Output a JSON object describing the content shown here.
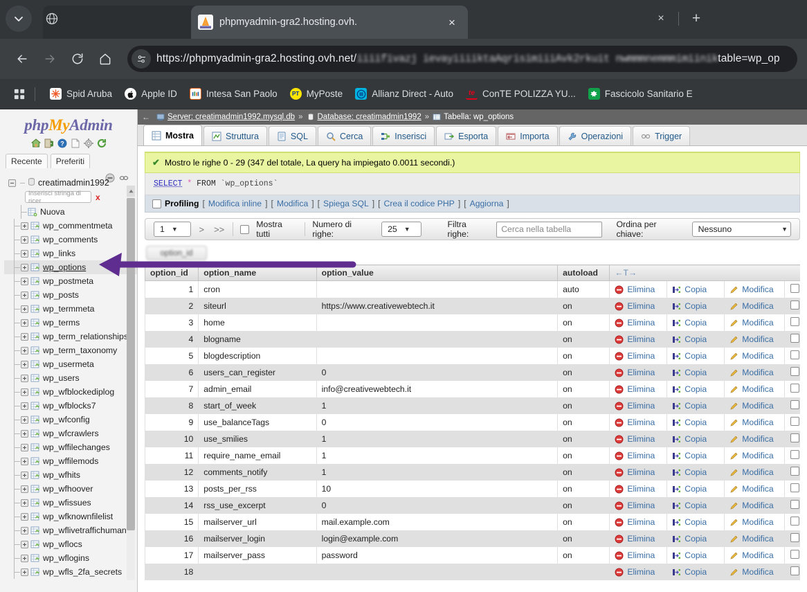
{
  "browser": {
    "tab": {
      "title": "phpmyadmin-gra2.hosting.ovh.",
      "favicon": "phpmyadmin-favicon",
      "close": "×"
    },
    "new_tab_label": "+",
    "window_close_label": "×",
    "omnibox": {
      "url_visible": "https://phpmyadmin-gra2.hosting.ovh.net/",
      "url_blurred": "iiiifivazj ievayiiiiktaAqrisimiiiAvk2rkuit nwmmmnemmmimiinik",
      "url_tail": "table=wp_op",
      "site_info_icon": "site-settings-icon"
    },
    "bookmarks": [
      {
        "label": "Spid Aruba",
        "icon": "spid-aruba-icon"
      },
      {
        "label": "Apple ID",
        "icon": "apple-icon"
      },
      {
        "label": "Intesa San Paolo",
        "icon": "intesa-icon"
      },
      {
        "label": "MyPoste",
        "icon": "poste-icon"
      },
      {
        "label": "Allianz Direct - Auto",
        "icon": "allianz-icon"
      },
      {
        "label": "ConTE POLIZZA YU...",
        "icon": "conte-icon"
      },
      {
        "label": "Fascicolo Sanitario E",
        "icon": "fascicolo-icon"
      }
    ]
  },
  "sidebar": {
    "logo": {
      "php": "php",
      "my": "My",
      "admin": "Admin"
    },
    "quick_icons": [
      "home-icon",
      "logout-icon",
      "help-icon",
      "docs-icon",
      "settings-icon",
      "refresh-icon"
    ],
    "tabs": [
      {
        "label": "Recente"
      },
      {
        "label": "Preferiti"
      }
    ],
    "database": "creatimadmin1992",
    "search_placeholder": "Inserisci stringa di ricer",
    "search_clear": "x",
    "new_label": "Nuova",
    "tables": [
      "wp_commentmeta",
      "wp_comments",
      "wp_links",
      "wp_options",
      "wp_postmeta",
      "wp_posts",
      "wp_termmeta",
      "wp_terms",
      "wp_term_relationships",
      "wp_term_taxonomy",
      "wp_usermeta",
      "wp_users",
      "wp_wfblockediplog",
      "wp_wfblocks7",
      "wp_wfconfig",
      "wp_wfcrawlers",
      "wp_wffilechanges",
      "wp_wffilemods",
      "wp_wfhits",
      "wp_wfhoover",
      "wp_wfissues",
      "wp_wfknownfilelist",
      "wp_wflivetraffichuman",
      "wp_wflocs",
      "wp_wflogins",
      "wp_wfls_2fa_secrets"
    ],
    "selected_table": "wp_options"
  },
  "breadcrumb": {
    "back": "←",
    "server_label": "Server: creatimadmin1992.mysql.db",
    "database_label": "Database: creatimadmin1992",
    "table_label": "Tabella: wp_options",
    "separator": "»"
  },
  "main_tabs": [
    {
      "label": "Mostra",
      "icon": "browse-icon",
      "active": true
    },
    {
      "label": "Struttura",
      "icon": "structure-icon",
      "active": false
    },
    {
      "label": "SQL",
      "icon": "sql-icon",
      "active": false
    },
    {
      "label": "Cerca",
      "icon": "search-icon",
      "active": false
    },
    {
      "label": "Inserisci",
      "icon": "insert-icon",
      "active": false
    },
    {
      "label": "Esporta",
      "icon": "export-icon",
      "active": false
    },
    {
      "label": "Importa",
      "icon": "import-icon",
      "active": false
    },
    {
      "label": "Operazioni",
      "icon": "operations-icon",
      "active": false
    },
    {
      "label": "Trigger",
      "icon": "trigger-icon",
      "active": false
    }
  ],
  "result_message": "Mostro le righe 0 - 29 (347 del totale, La query ha impiegato 0.0011 secondi.)",
  "sql_query": {
    "keyword": "SELECT",
    "star": "*",
    "from": "FROM",
    "table": "`wp_options`"
  },
  "profiling": {
    "label": "Profiling",
    "links": [
      "Modifica inline",
      "Modifica",
      "Spiega SQL",
      "Crea il codice PHP",
      "Aggiorna"
    ]
  },
  "toolbar": {
    "page_select": "1",
    "next_label": ">",
    "last_label": ">>",
    "show_all_label": "Mostra tutti",
    "rows_label": "Numero di righe:",
    "rows_value": "25",
    "filter_label": "Filtra righe:",
    "filter_placeholder": "Cerca nella tabella",
    "sort_label": "Ordina per chiave:",
    "sort_value": "Nessuno"
  },
  "obscured_button": "option_id",
  "table": {
    "columns": [
      "option_id",
      "option_name",
      "option_value",
      "autoload"
    ],
    "sort_hint": "←T→",
    "actions": {
      "delete": "Elimina",
      "copy": "Copia",
      "edit": "Modifica"
    },
    "rows": [
      {
        "id": "1",
        "name": "cron",
        "value": "",
        "autoload": "auto"
      },
      {
        "id": "2",
        "name": "siteurl",
        "value": "https://www.creativewebtech.it",
        "autoload": "on"
      },
      {
        "id": "3",
        "name": "home",
        "value": "",
        "autoload": "on"
      },
      {
        "id": "4",
        "name": "blogname",
        "value": "",
        "autoload": "on"
      },
      {
        "id": "5",
        "name": "blogdescription",
        "value": "",
        "autoload": "on"
      },
      {
        "id": "6",
        "name": "users_can_register",
        "value": "0",
        "autoload": "on"
      },
      {
        "id": "7",
        "name": "admin_email",
        "value": "info@creativewebtech.it",
        "autoload": "on"
      },
      {
        "id": "8",
        "name": "start_of_week",
        "value": "1",
        "autoload": "on"
      },
      {
        "id": "9",
        "name": "use_balanceTags",
        "value": "0",
        "autoload": "on"
      },
      {
        "id": "10",
        "name": "use_smilies",
        "value": "1",
        "autoload": "on"
      },
      {
        "id": "11",
        "name": "require_name_email",
        "value": "1",
        "autoload": "on"
      },
      {
        "id": "12",
        "name": "comments_notify",
        "value": "1",
        "autoload": "on"
      },
      {
        "id": "13",
        "name": "posts_per_rss",
        "value": "10",
        "autoload": "on"
      },
      {
        "id": "14",
        "name": "rss_use_excerpt",
        "value": "0",
        "autoload": "on"
      },
      {
        "id": "15",
        "name": "mailserver_url",
        "value": "mail.example.com",
        "autoload": "on"
      },
      {
        "id": "16",
        "name": "mailserver_login",
        "value": "login@example.com",
        "autoload": "on"
      },
      {
        "id": "17",
        "name": "mailserver_pass",
        "value": "password",
        "autoload": "on"
      },
      {
        "id": "18",
        "name": "",
        "value": "",
        "autoload": ""
      }
    ]
  },
  "annotation": {
    "arrow_color": "#5f2d8f"
  }
}
